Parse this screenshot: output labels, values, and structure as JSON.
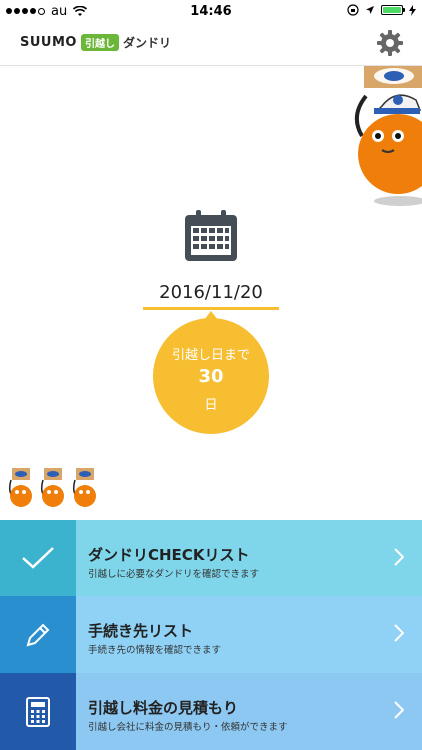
{
  "status": {
    "carrier": "au",
    "time": "14:46"
  },
  "header": {
    "logo_suumo": "SUUMO",
    "logo_badge": "引越し",
    "logo_dandori": "ダンドリ"
  },
  "countdown": {
    "date": "2016/11/20",
    "label": "引越し日まで",
    "days": "30",
    "unit": "日"
  },
  "menu": {
    "items": [
      {
        "title": "ダンドリCHECKリスト",
        "subtitle": "引越しに必要なダンドリを確認できます",
        "icon": "checkmark-icon",
        "icon_bg": "#3bb3cf",
        "bg": "#7fd6ea"
      },
      {
        "title": "手続き先リスト",
        "subtitle": "手続き先の情報を確認できます",
        "icon": "pencil-icon",
        "icon_bg": "#2a8fcf",
        "bg": "#8fd2f6"
      },
      {
        "title": "引越し料金の見積もり",
        "subtitle": "引越し会社に料金の見積もり・依頼ができます",
        "icon": "calculator-icon",
        "icon_bg": "#2259a8",
        "bg": "#8dc8f2"
      }
    ]
  },
  "colors": {
    "accent": "#f7be32",
    "mascot_orange": "#f07e0a"
  }
}
